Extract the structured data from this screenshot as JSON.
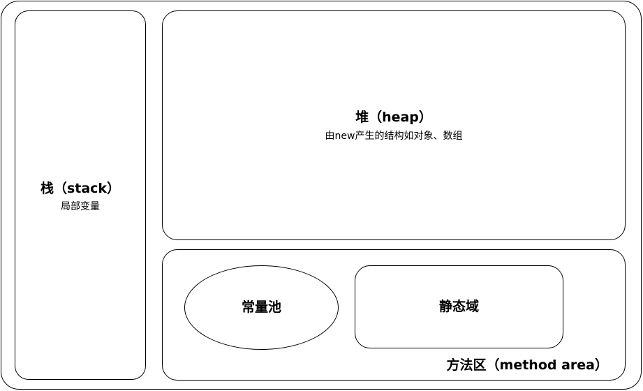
{
  "stack": {
    "title": "栈（stack）",
    "subtitle": "局部变量"
  },
  "heap": {
    "title": "堆（heap）",
    "subtitle": "由new产生的结构如对象、数组"
  },
  "method_area": {
    "label": "方法区（method area）",
    "constant_pool": "常量池",
    "static_area": "静态域"
  }
}
